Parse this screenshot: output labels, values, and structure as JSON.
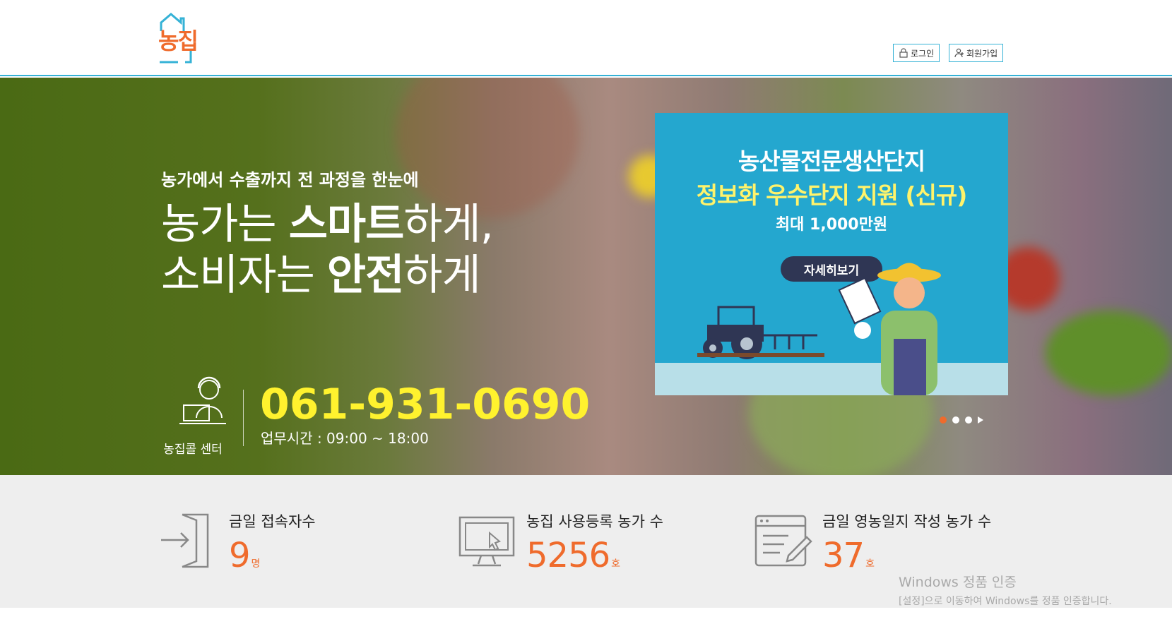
{
  "header": {
    "logo_text": "농집",
    "login_label": "로그인",
    "join_label": "회원가입"
  },
  "hero": {
    "subtitle": "농가에서 수출까지 전 과정을 한눈에",
    "line1_pre": "농가는 ",
    "line1_bold": "스마트",
    "line1_post": "하게,",
    "line2_pre": "소비자는 ",
    "line2_bold": "안전",
    "line2_post": "하게",
    "call_center_label": "농집콜 센터",
    "phone": "061-931-0690",
    "hours": "업무시간 : 09:00 ~ 18:00"
  },
  "banner": {
    "title": "농산물전문생산단지",
    "highlight": "정보화 우수단지 지원 (신규)",
    "amount": "최대 1,000만원",
    "button": "자세히보기"
  },
  "slider": {
    "active_index": 0,
    "count": 3
  },
  "stats": [
    {
      "label": "금일 접속자수",
      "value": "9",
      "unit": "명",
      "icon": "door-enter-icon"
    },
    {
      "label": "농집 사용등록 농가 수",
      "value": "5256",
      "unit": "호",
      "icon": "monitor-click-icon"
    },
    {
      "label": "금일 영농일지 작성 농가 수",
      "value": "37",
      "unit": "호",
      "icon": "journal-edit-icon"
    }
  ],
  "watermark": {
    "line1": "Windows 정품 인증",
    "line2": "[설정]으로 이동하여 Windows를 정품 인증합니다."
  },
  "colors": {
    "accent": "#ef6b2c",
    "teal": "#35b2d6",
    "phone": "#fff22e",
    "banner": "#24a7cf"
  }
}
